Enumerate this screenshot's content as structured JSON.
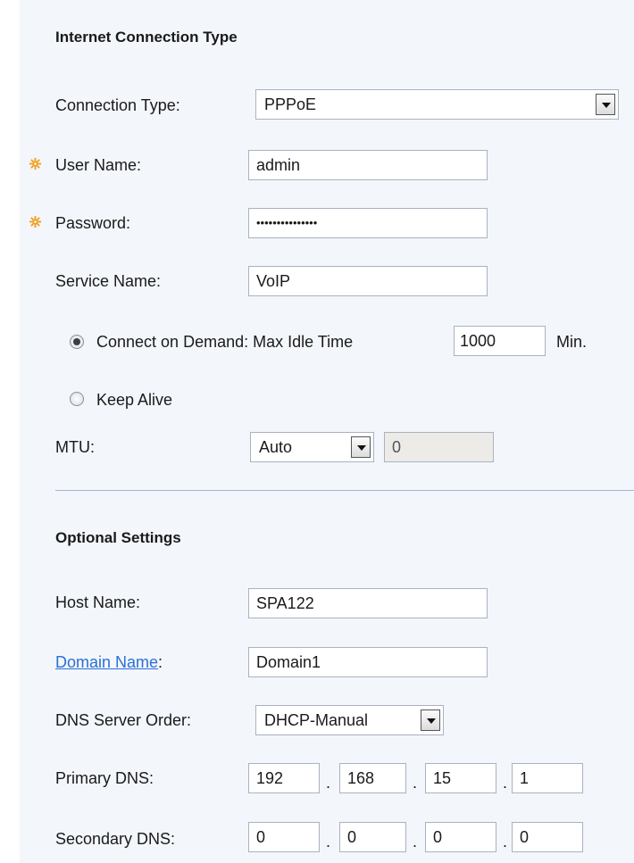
{
  "colors": {
    "panel_bg": "#f3f6fb",
    "required_icon": "#f0a020",
    "link": "#2a6fd6",
    "divider": "#9fb6d6"
  },
  "internet": {
    "title": "Internet Connection Type",
    "connection_type": {
      "label": "Connection Type:",
      "value": "PPPoE"
    },
    "user_name": {
      "label": "User Name:",
      "value": "admin"
    },
    "password": {
      "label": "Password:",
      "value": "•••••••••••••••"
    },
    "service_name": {
      "label": "Service Name:",
      "value": "VoIP"
    },
    "connect_on_demand": {
      "label": "Connect on Demand: Max Idle Time",
      "value": "1000",
      "unit": "Min.",
      "selected": true
    },
    "keep_alive": {
      "label": "Keep Alive",
      "selected": false
    },
    "mtu": {
      "label": "MTU:",
      "mode": "Auto",
      "size": "0"
    }
  },
  "optional": {
    "title": "Optional Settings",
    "host_name": {
      "label": "Host Name:",
      "value": "SPA122"
    },
    "domain_name": {
      "label": "Domain Name",
      "colon": ":",
      "value": "Domain1"
    },
    "dns_order": {
      "label": "DNS Server Order:",
      "value": "DHCP-Manual"
    },
    "primary_dns": {
      "label": "Primary DNS:",
      "octets": [
        "192",
        "168",
        "15",
        "1"
      ]
    },
    "secondary_dns": {
      "label": "Secondary DNS:",
      "octets": [
        "0",
        "0",
        "0",
        "0"
      ]
    },
    "dot": "."
  }
}
